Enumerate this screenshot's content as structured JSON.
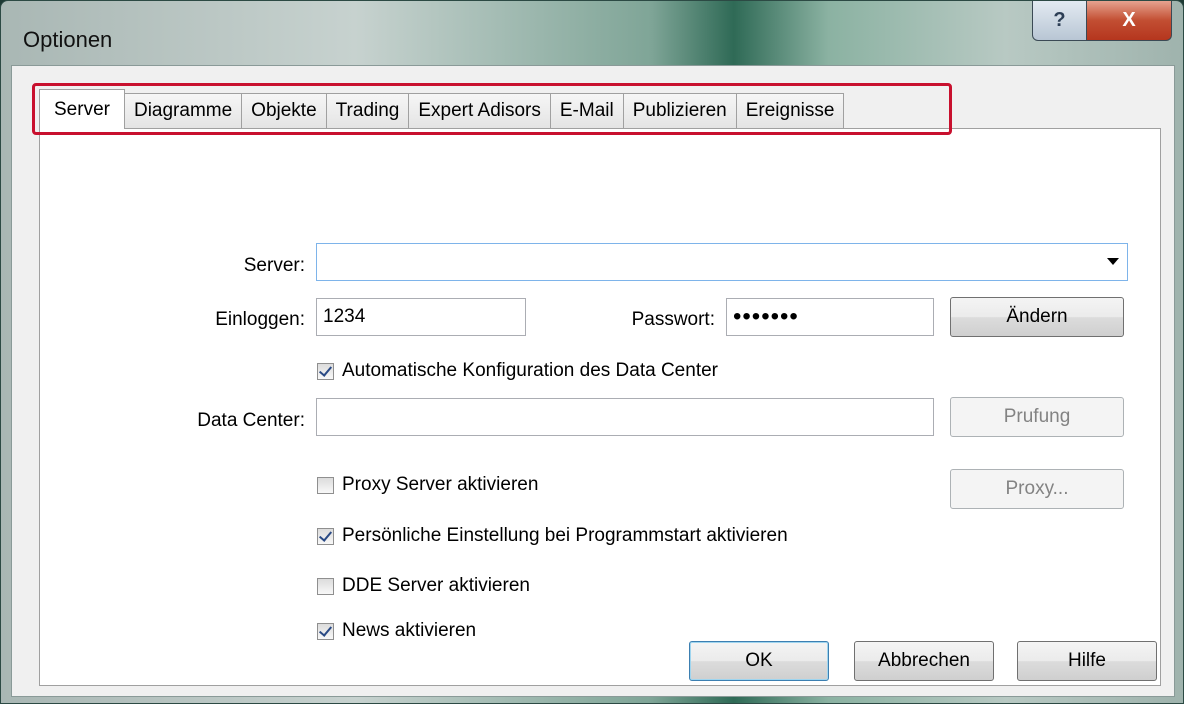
{
  "window": {
    "title": "Optionen",
    "help_label": "?",
    "close_label": "X"
  },
  "tabs": [
    {
      "label": "Server"
    },
    {
      "label": "Diagramme"
    },
    {
      "label": "Objekte"
    },
    {
      "label": "Trading"
    },
    {
      "label": "Expert Adisors"
    },
    {
      "label": "E-Mail"
    },
    {
      "label": "Publizieren"
    },
    {
      "label": "Ereignisse"
    }
  ],
  "form": {
    "server_label": "Server:",
    "server_value": "",
    "login_label": "Einloggen:",
    "login_value": "1234",
    "password_label": "Passwort:",
    "password_value": "•••••••",
    "change_button": "Ändern",
    "auto_config_label": "Automatische Konfiguration des Data Center",
    "auto_config_checked": true,
    "datacenter_label": "Data Center:",
    "datacenter_value": "",
    "check_button": "Prufung",
    "proxy_enable_label": "Proxy Server aktivieren",
    "proxy_enable_checked": false,
    "proxy_button": "Proxy...",
    "personal_label": "Persönliche Einstellung bei Programmstart aktivieren",
    "personal_checked": true,
    "dde_label": "DDE Server aktivieren",
    "dde_checked": false,
    "news_label": "News aktivieren",
    "news_checked": true
  },
  "footer": {
    "ok": "OK",
    "cancel": "Abbrechen",
    "help": "Hilfe"
  },
  "colors": {
    "highlight": "#c8102e",
    "close_button": "#c24e32"
  }
}
